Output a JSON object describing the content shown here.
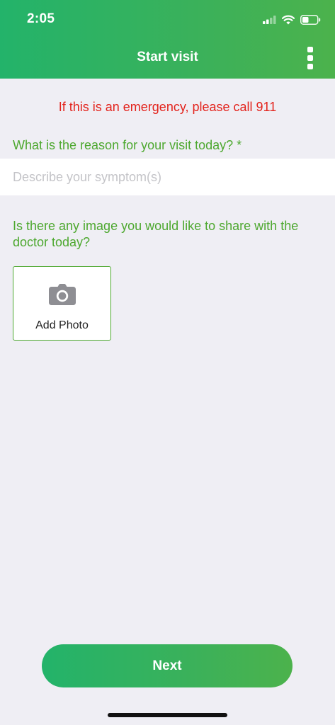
{
  "status_bar": {
    "time": "2:05"
  },
  "header": {
    "title": "Start visit"
  },
  "emergency_notice": "If this is an emergency, please call 911",
  "reason": {
    "question": "What is the reason for your visit today? *",
    "placeholder": "Describe your symptom(s)",
    "value": ""
  },
  "image": {
    "question": "Is there any image you would like to share with the doctor today?",
    "add_photo_label": "Add Photo"
  },
  "next_label": "Next",
  "colors": {
    "brand_green": "#3bb15a",
    "question_green": "#4da82f",
    "emergency_red": "#e3231c",
    "background": "#efeef4"
  },
  "icons": [
    "signal-icon",
    "wifi-icon",
    "battery-icon",
    "more-vertical-icon",
    "camera-icon"
  ]
}
